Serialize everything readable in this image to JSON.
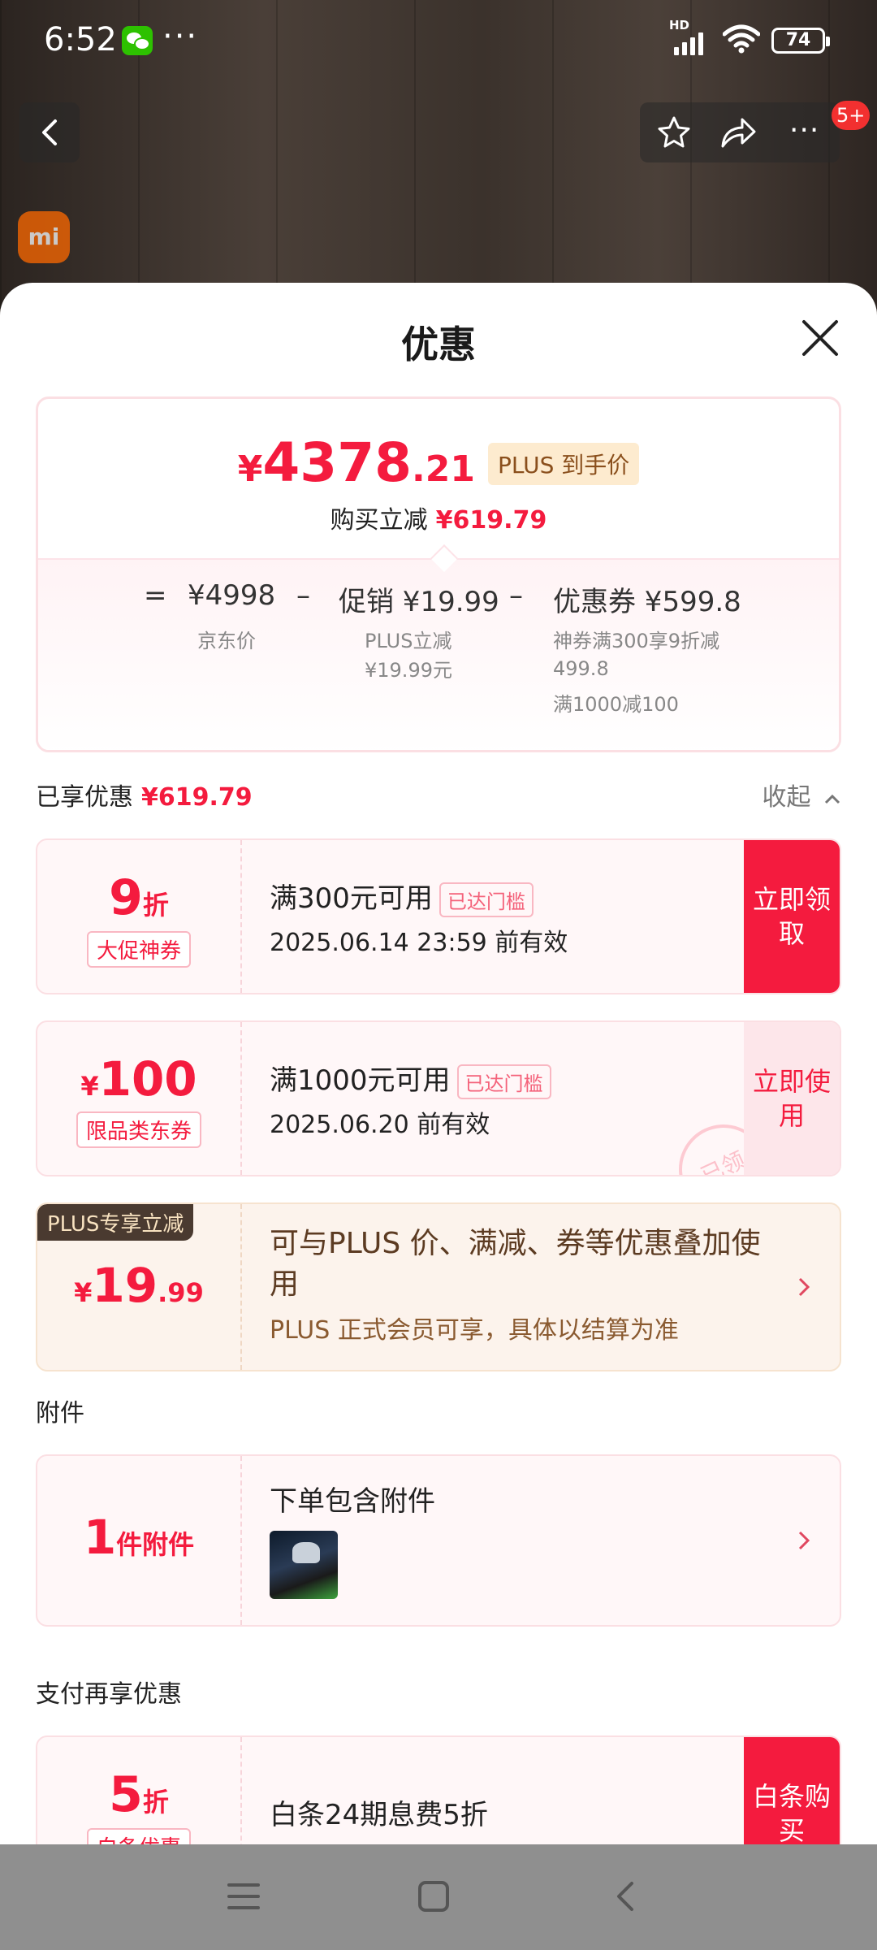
{
  "status": {
    "time": "6:52",
    "dots": "···",
    "hd": "HD",
    "battery": "74"
  },
  "nav": {
    "badge": "5+",
    "brand_logo": "mi"
  },
  "sheet": {
    "title": "优惠"
  },
  "price": {
    "currency": "¥",
    "integer": "4378",
    "decimal": ".21",
    "tag": "PLUS 到手价",
    "reduce_label": "购买立减",
    "reduce_value": "¥619.79",
    "formula": {
      "eq": "=",
      "jd_price": "¥4998",
      "minus1": "–",
      "promo": "促销 ¥19.99",
      "minus2": "–",
      "coupon": "优惠券 ¥599.8",
      "jd_price_label": "京东价",
      "promo_sub1": "PLUS立减",
      "promo_sub2": "¥19.99元",
      "coupon_sub1": "神券满300享9折减",
      "coupon_sub2": "499.8",
      "coupon_sub3": "满1000减100"
    }
  },
  "enjoyed": {
    "label": "已享优惠",
    "value": "¥619.79",
    "collapse": "收起"
  },
  "coupons": [
    {
      "discount_num": "9",
      "discount_unit": "折",
      "tag": "大促神券",
      "condition": "满300元可用",
      "cond_tag": "已达门槛",
      "valid": "2025.06.14 23:59 前有效",
      "action": "立即领取"
    },
    {
      "currency": "¥",
      "discount_num": "100",
      "tag": "限品类东券",
      "condition": "满1000元可用",
      "cond_tag": "已达门槛",
      "valid": "2025.06.20 前有效",
      "action": "立即使用",
      "stamp": "已领"
    }
  ],
  "plus": {
    "corner": "PLUS专享立减",
    "currency": "¥",
    "integer": "19",
    "decimal": ".99",
    "main": "可与PLUS 价、满减、券等优惠叠加使用",
    "sub": "PLUS 正式会员可享，具体以结算为准"
  },
  "attachment": {
    "section": "附件",
    "count": "1",
    "unit": "件附件",
    "title": "下单包含附件"
  },
  "payment": {
    "section": "支付再享优惠",
    "discount_num": "5",
    "discount_unit": "折",
    "tag": "白条优惠",
    "title": "白条24期息费5折",
    "action": "白条购买"
  }
}
